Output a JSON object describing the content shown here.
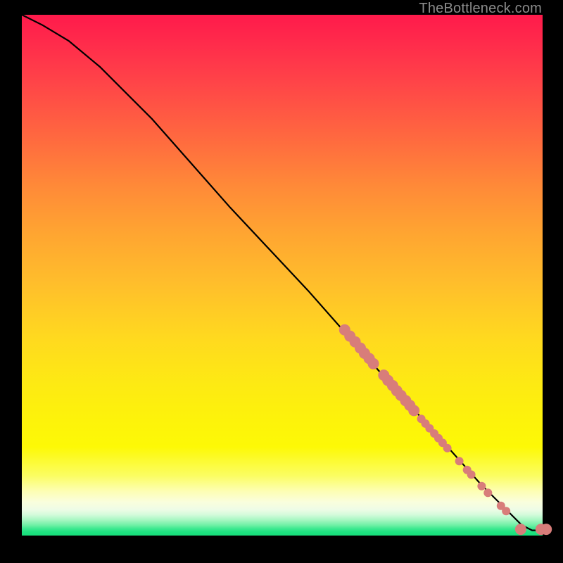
{
  "watermark": {
    "text": "TheBottleneck.com"
  },
  "chart_data": {
    "type": "line",
    "title": "",
    "xlabel": "",
    "ylabel": "",
    "xlim": [
      0,
      100
    ],
    "ylim": [
      0,
      100
    ],
    "series": [
      {
        "name": "curve",
        "x": [
          0,
          4,
          9,
          15,
          25,
          40,
          55,
          70,
          80,
          88,
          93,
          96,
          98,
          100
        ],
        "values": [
          100,
          98,
          95,
          90,
          80,
          63,
          47,
          30,
          19,
          10,
          5,
          2,
          1,
          1
        ]
      }
    ],
    "markers": {
      "name": "highlight-points",
      "color": "#d87d7a",
      "radius_small": 6,
      "radius_large": 8,
      "points": [
        {
          "x": 62.0,
          "y": 39.5,
          "r": 8
        },
        {
          "x": 63.0,
          "y": 38.3,
          "r": 8
        },
        {
          "x": 64.0,
          "y": 37.2,
          "r": 8
        },
        {
          "x": 65.0,
          "y": 36.0,
          "r": 8
        },
        {
          "x": 65.8,
          "y": 35.0,
          "r": 8
        },
        {
          "x": 66.7,
          "y": 34.0,
          "r": 8
        },
        {
          "x": 67.5,
          "y": 33.0,
          "r": 8
        },
        {
          "x": 69.5,
          "y": 30.8,
          "r": 8
        },
        {
          "x": 70.3,
          "y": 29.8,
          "r": 8
        },
        {
          "x": 71.2,
          "y": 28.8,
          "r": 8
        },
        {
          "x": 72.0,
          "y": 27.8,
          "r": 8
        },
        {
          "x": 72.8,
          "y": 26.9,
          "r": 8
        },
        {
          "x": 73.7,
          "y": 25.9,
          "r": 8
        },
        {
          "x": 74.5,
          "y": 25.0,
          "r": 8
        },
        {
          "x": 75.3,
          "y": 24.0,
          "r": 8
        },
        {
          "x": 76.7,
          "y": 22.4,
          "r": 6
        },
        {
          "x": 77.5,
          "y": 21.5,
          "r": 6
        },
        {
          "x": 78.3,
          "y": 20.6,
          "r": 6
        },
        {
          "x": 79.2,
          "y": 19.6,
          "r": 6
        },
        {
          "x": 80.0,
          "y": 18.7,
          "r": 6
        },
        {
          "x": 80.8,
          "y": 17.8,
          "r": 6
        },
        {
          "x": 81.7,
          "y": 16.8,
          "r": 6
        },
        {
          "x": 84.0,
          "y": 14.3,
          "r": 6
        },
        {
          "x": 85.5,
          "y": 12.6,
          "r": 6
        },
        {
          "x": 86.3,
          "y": 11.7,
          "r": 6
        },
        {
          "x": 88.3,
          "y": 9.5,
          "r": 6
        },
        {
          "x": 89.5,
          "y": 8.2,
          "r": 6
        },
        {
          "x": 92.0,
          "y": 5.7,
          "r": 6
        },
        {
          "x": 93.0,
          "y": 4.7,
          "r": 6
        },
        {
          "x": 95.8,
          "y": 1.2,
          "r": 8
        },
        {
          "x": 99.7,
          "y": 1.2,
          "r": 8
        },
        {
          "x": 100.7,
          "y": 1.2,
          "r": 8
        }
      ]
    }
  }
}
